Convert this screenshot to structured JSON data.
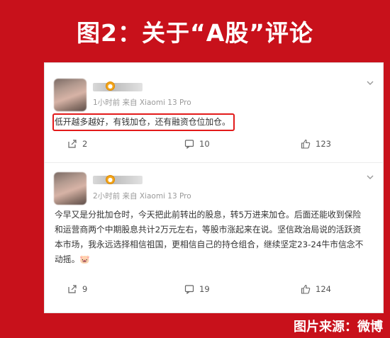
{
  "banner": {
    "title": "图2：关于“A股”评论"
  },
  "comments": [
    {
      "meta": "1小时前  来自 Xiaomi 13 Pro",
      "text": "低开越多越好，有钱加仓，还有融资仓位加仓。",
      "actions": {
        "repost": "2",
        "comment": "10",
        "like": "123"
      }
    },
    {
      "meta": "2小时前  来自 Xiaomi 13 Pro",
      "text": "今早又是分批加仓时，今天把此前转出的股息，转5万进来加仓。后面还能收到保险和运营商两个中期股息共计2万元左右，等股市涨起来在说。坚信政治局说的活跃资本市场，我永远选择相信祖国，更相信自己的持仓组合，继续坚定23-24牛市信念不动摇。🐷",
      "actions": {
        "repost": "9",
        "comment": "19",
        "like": "124"
      }
    }
  ],
  "footer": {
    "source": "图片来源：微博"
  },
  "colors": {
    "banner_bg": "#c8111b",
    "highlight": "#e21a1a",
    "badge": "#f2a51a"
  }
}
